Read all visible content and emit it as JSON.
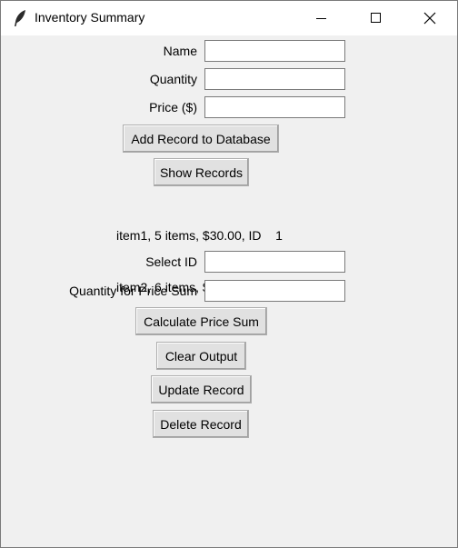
{
  "window": {
    "title": "Inventory Summary",
    "icon": "feather-icon"
  },
  "form": {
    "name_label": "Name",
    "name_value": "",
    "quantity_label": "Quantity",
    "quantity_value": "",
    "price_label": "Price ($)",
    "price_value": ""
  },
  "buttons": {
    "add_record": "Add Record to Database",
    "show_records": "Show Records",
    "calculate_price_sum": "Calculate Price Sum",
    "clear_output": "Clear Output",
    "update_record": "Update Record",
    "delete_record": "Delete Record"
  },
  "records": [
    "item1, 5 items, $30.00, ID    1",
    "item2, 6 items, $20.00, ID    2"
  ],
  "selection": {
    "select_id_label": "Select ID",
    "select_id_value": "",
    "qty_sum_label": "Quantity for Price Sum",
    "qty_sum_value": ""
  }
}
